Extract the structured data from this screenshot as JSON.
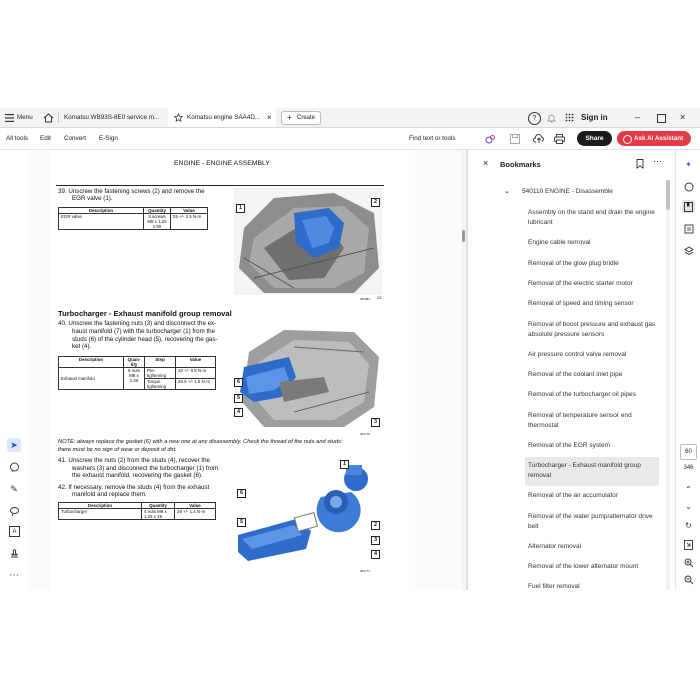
{
  "tabs": {
    "menu_label": "Menu",
    "tab1_label": "Komatsu WB93S-8E0 service m...",
    "tab2_label": "Komatsu engine SAA4D...",
    "create_label": "Create",
    "sign_in_label": "Sign in"
  },
  "toolbar": {
    "all_tools": "All tools",
    "edit": "Edit",
    "convert": "Convert",
    "esign": "E-Sign",
    "find": "Find text or tools",
    "share": "Share",
    "ask_ai": "Ask AI Assistant"
  },
  "page": {
    "header": "ENGINE - ENGINE ASSEMBLY",
    "step39": "39.   Unscrew the fastening screws (2) and remove the",
    "step39b": "EGR valve (1).",
    "t1": {
      "h1": "Description",
      "h2": "Quantity",
      "h3": "Value",
      "r1c1": "EGR valve",
      "r1c2": "3 screws M8 x 1.25 x 90",
      "r1c3": "25 +/- 2.5 N·m"
    },
    "fig1_code": "281981",
    "section_title": "Turbocharger - Exhaust manifold group removal",
    "step40a": "40.   Unscrew the fastening nuts (3) and disconnect the ex-",
    "step40b": "haust manifold (7) with the turbocharger (1) from the",
    "step40c": "studs (6) of the cylinder head (5), recovering the gas-",
    "step40d": "ket (4).",
    "t2": {
      "h1": "Description",
      "h2": "Quan-tity",
      "h3": "Step",
      "h4": "Value",
      "r1c1": "Exhaust manifold",
      "r1c2": "8 nuts M8 x 1.25",
      "r1c3a": "Pre-tightening",
      "r1c4a": "10 +/- 0.5 N·m",
      "r1c3b": "Torque tightening",
      "r1c4b": "28.5 +/- 1.5 N·m"
    },
    "fig2_code": "281776",
    "note1": "NOTE: always replace the gasket (6) with a new one at any disassembly. Check the thread of the nuts and studs:",
    "note2": "there must be no sign of wear or deposit of dirt.",
    "step41a": "41.   Unscrew the nuts (2) from the studs (4), recover the",
    "step41b": "washers (3) and disconnect the turbocharger (1) from",
    "step41c": "the exhaust manifold, recovering the gasket (6).",
    "step42a": "42.   If necessary, remove the studs (4) from the exhaust",
    "step42b": "manifold and replace them.",
    "t3": {
      "h1": "Description",
      "h2": "Quantity",
      "h3": "Value",
      "r1c1": "Turbocharger",
      "r1c2": "4 nuts M8 x 1.25 x 25",
      "r1c3": "28 +/- 1.4 N·m"
    },
    "fig3_code": "281777",
    "page_num_small": "22",
    "callouts": {
      "c1": "1",
      "c2": "2",
      "c3": "3",
      "c4": "4",
      "c5": "5",
      "c6": "6",
      "c7": "7"
    }
  },
  "bookmarks": {
    "title": "Bookmarks",
    "parent": "540110   ENGINE - Disassemble",
    "items": [
      "Assembly on the stand end drain the engine lubricant",
      "Engine cable removal",
      "Removal of the glow plug bridle",
      "Removal of the electric starter motor",
      "Removal of speed and timing sensor",
      "Removal of boost pressure and exhaust gas absolute pressure sensors",
      "Air pressure control valve removal",
      "Removal of the coolant inlet pipe",
      "Removal of the turbocharger oil pipes",
      "Removal of temperature sensor end thermostat",
      "Removal of the EGR system",
      "Turbocharger - Exhaust manifold group removal",
      "Removal of the air accumulator",
      "Removal of the water pump/alternator drive belt",
      "Alternator removal",
      "Removal of the lower alternator mount",
      "Fuel filter removal"
    ]
  },
  "navigation": {
    "current_page": "60",
    "total_pages": "346"
  },
  "colors": {
    "accent_red": "#e63946",
    "engine_blue": "#2f6bc9",
    "selected_bookmark_bg": "#e9e9e9"
  }
}
